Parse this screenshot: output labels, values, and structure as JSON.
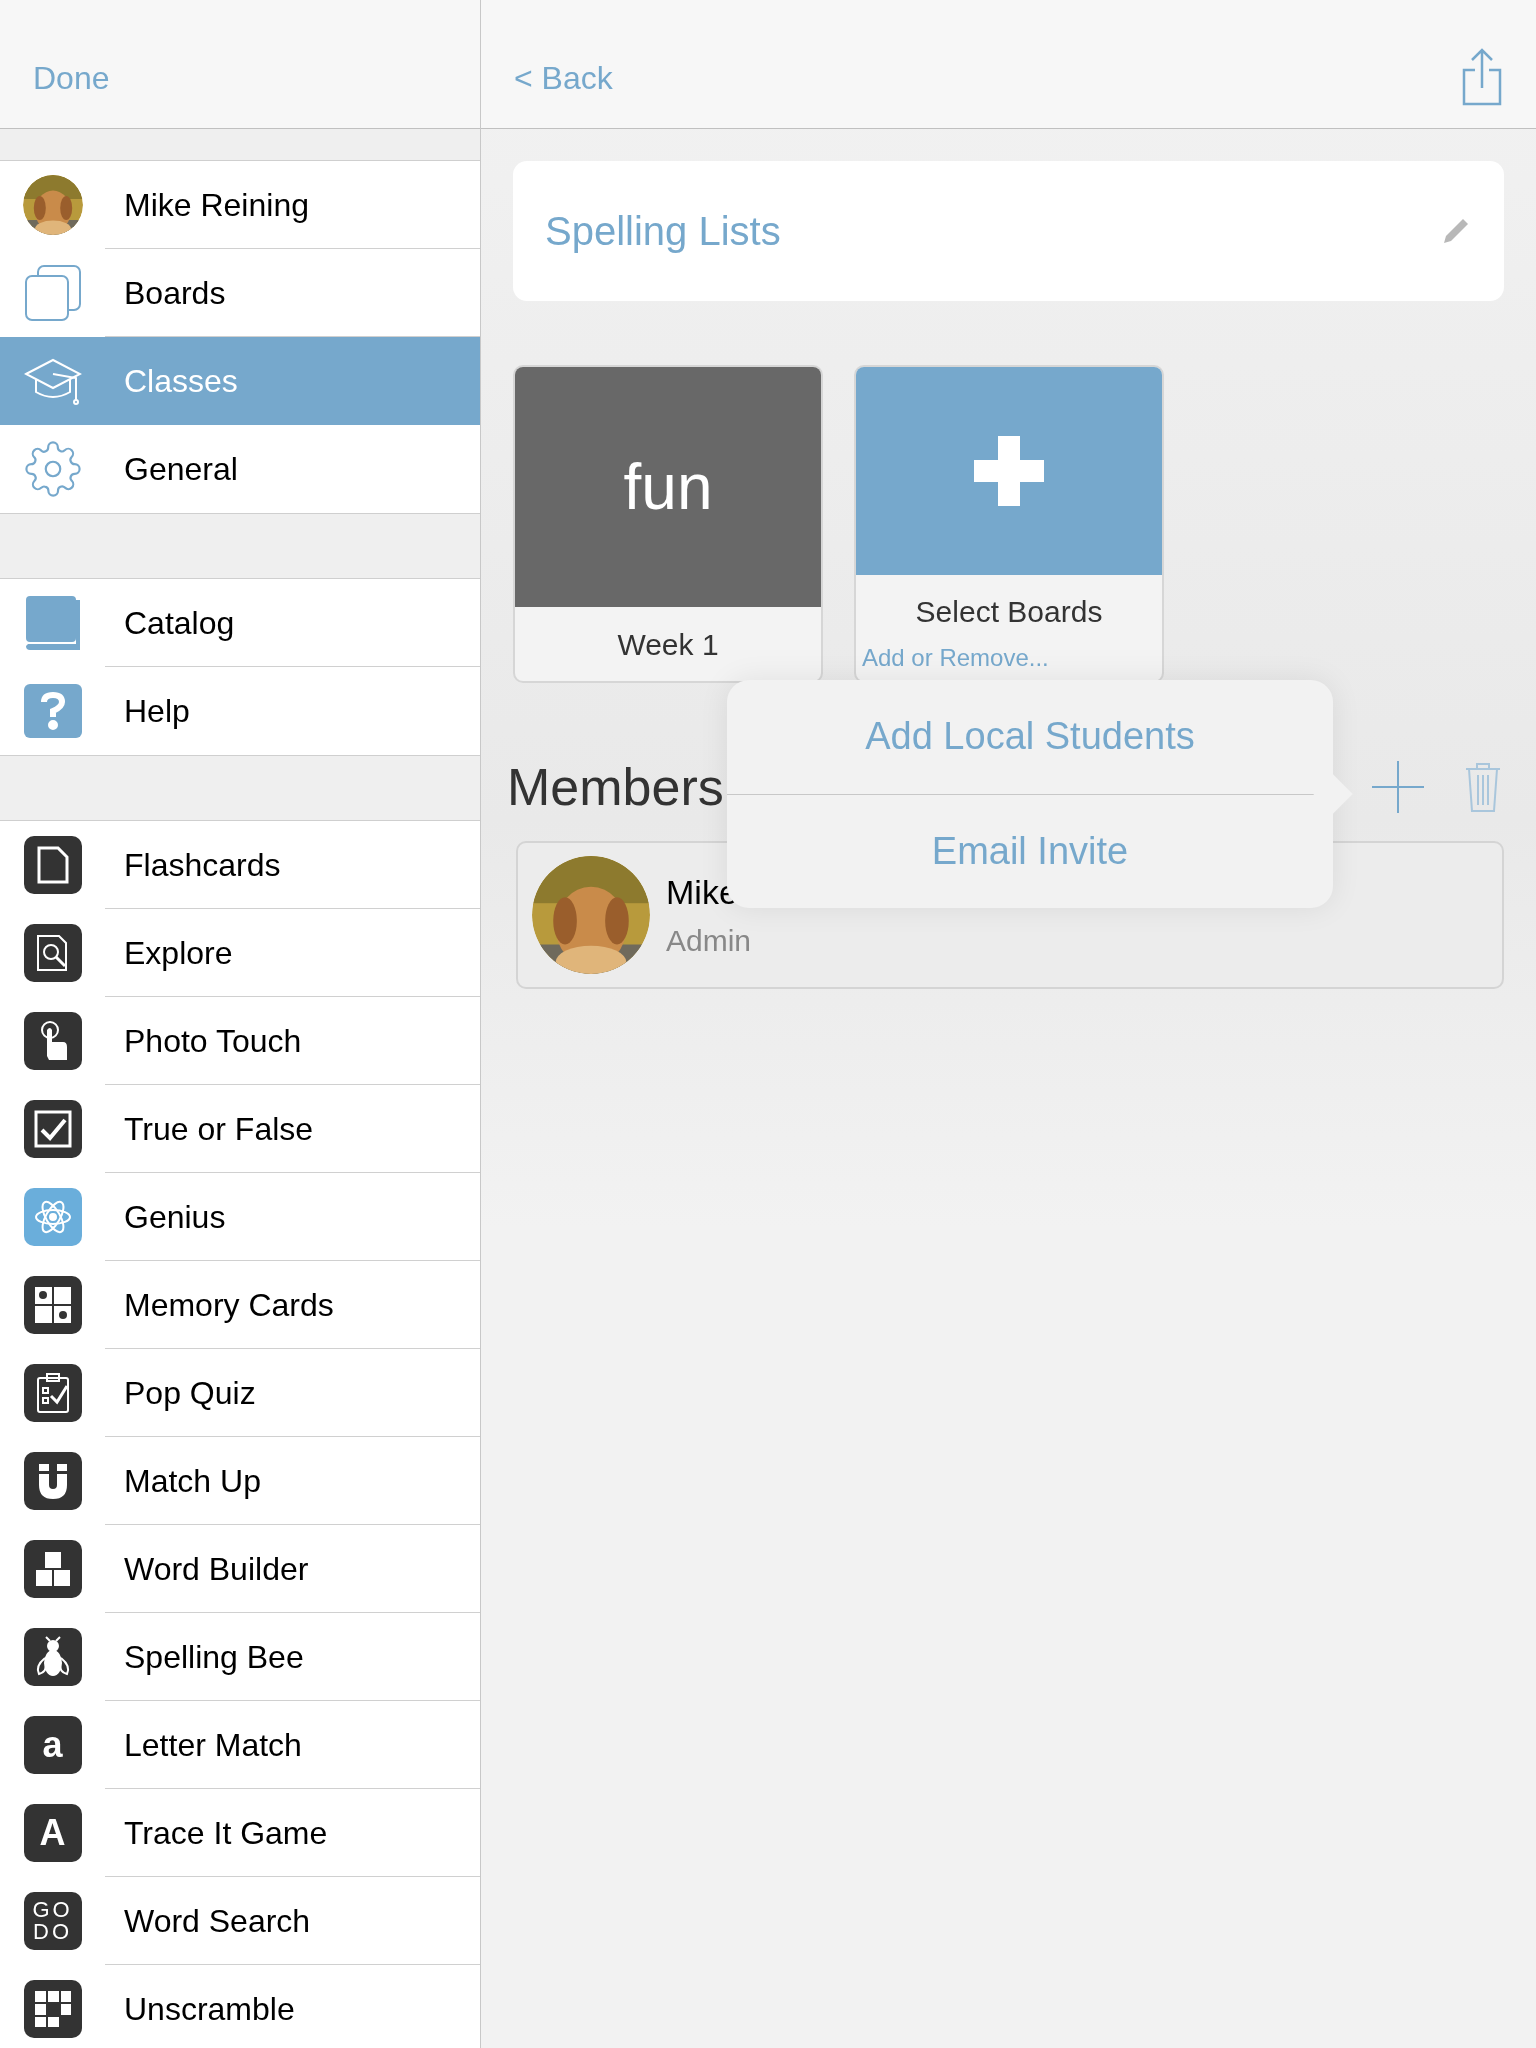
{
  "sidebar": {
    "done": "Done",
    "sections": [
      {
        "items": [
          {
            "label": "Mike Reining",
            "selected": false
          },
          {
            "label": "Boards",
            "selected": false
          },
          {
            "label": "Classes",
            "selected": true
          },
          {
            "label": "General",
            "selected": false
          }
        ]
      },
      {
        "items": [
          {
            "label": "Catalog",
            "selected": false
          },
          {
            "label": "Help",
            "selected": false
          }
        ]
      },
      {
        "items": [
          {
            "label": "Flashcards",
            "selected": false
          },
          {
            "label": "Explore",
            "selected": false
          },
          {
            "label": "Photo Touch",
            "selected": false
          },
          {
            "label": "True or False",
            "selected": false
          },
          {
            "label": "Genius",
            "selected": false
          },
          {
            "label": "Memory Cards",
            "selected": false
          },
          {
            "label": "Pop Quiz",
            "selected": false
          },
          {
            "label": "Match Up",
            "selected": false
          },
          {
            "label": "Word Builder",
            "selected": false
          },
          {
            "label": "Spelling Bee",
            "selected": false
          },
          {
            "label": "Letter Match",
            "selected": false,
            "glyph": [
              "a"
            ]
          },
          {
            "label": "Trace It Game",
            "selected": false,
            "glyph": [
              "A"
            ]
          },
          {
            "label": "Word Search",
            "selected": false,
            "glyph": [
              "GO",
              "DO"
            ]
          },
          {
            "label": "Unscramble",
            "selected": false
          }
        ]
      }
    ]
  },
  "nav": {
    "back": "< Back"
  },
  "class_title": "Spelling Lists",
  "boards": [
    {
      "kind": "board",
      "title": "fun",
      "label": "Week 1"
    },
    {
      "kind": "add",
      "title": "Select Boards",
      "subtitle": "Add or Remove..."
    }
  ],
  "members": {
    "heading": "Members",
    "list": [
      {
        "name": "Mike",
        "role": "Admin"
      }
    ]
  },
  "popover": {
    "items": [
      "Add Local Students",
      "Email Invite"
    ]
  }
}
